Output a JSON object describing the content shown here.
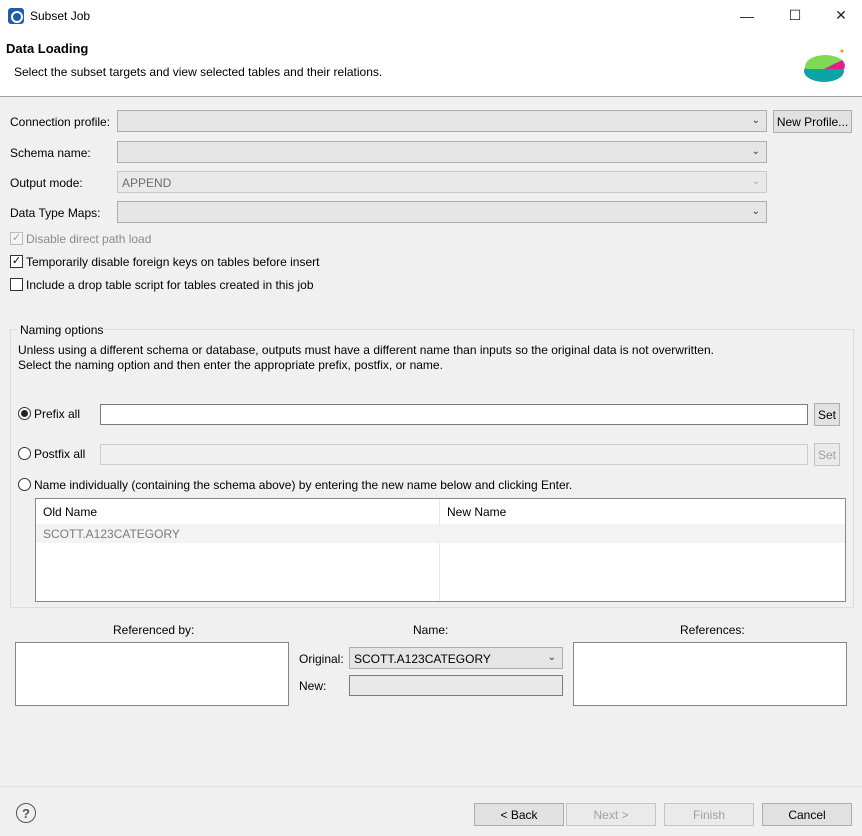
{
  "window": {
    "title": "Subset Job",
    "minimize": "—",
    "maximize": "☐",
    "close": "✕"
  },
  "header": {
    "title": "Data Loading",
    "description": "Select the subset targets and view selected tables and their relations."
  },
  "form": {
    "connection_profile_label": "Connection profile:",
    "connection_profile_value": "",
    "new_profile_button": "New Profile...",
    "schema_name_label": "Schema name:",
    "schema_name_value": "",
    "output_mode_label": "Output mode:",
    "output_mode_value": "APPEND",
    "data_type_maps_label": "Data Type Maps:",
    "data_type_maps_value": "",
    "disable_direct_path_load": {
      "label": "Disable direct path load",
      "checked": true,
      "enabled": false
    },
    "disable_foreign_keys": {
      "label": "Temporarily disable foreign keys on tables before insert",
      "checked": true
    },
    "drop_table_script": {
      "label": "Include a drop table script for tables created in this job",
      "checked": false
    }
  },
  "naming": {
    "group_label": "Naming options",
    "desc_line1": "Unless using a different schema or database, outputs must have a different name than inputs so the original data is not overwritten.",
    "desc_line2": "Select the naming option and then enter the appropriate prefix, postfix, or name.",
    "prefix_label": "Prefix all",
    "prefix_value": "",
    "postfix_label": "Postfix all",
    "postfix_value": "",
    "set_button": "Set",
    "individual_label": "Name individually (containing the schema above) by entering the new name below and clicking Enter.",
    "selected_option": "prefix",
    "table": {
      "columns": [
        "Old Name",
        "New Name"
      ],
      "rows": [
        {
          "old": "SCOTT.A123CATEGORY",
          "new": ""
        }
      ]
    }
  },
  "relations": {
    "referenced_by_label": "Referenced by:",
    "name_label": "Name:",
    "references_label": "References:",
    "original_label": "Original:",
    "original_value": "SCOTT.A123CATEGORY",
    "new_label": "New:",
    "new_value": ""
  },
  "footer": {
    "help": "?",
    "back": "< Back",
    "next": "Next >",
    "finish": "Finish",
    "cancel": "Cancel"
  }
}
